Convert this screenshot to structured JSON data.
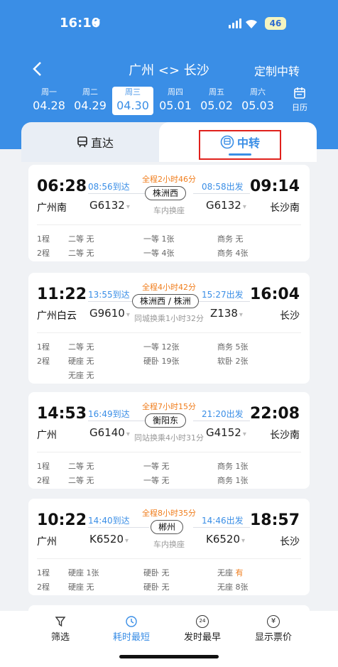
{
  "status_bar": {
    "time": "16:10",
    "battery": "46"
  },
  "nav": {
    "title": "广州 <> 长沙",
    "custom": "定制中转"
  },
  "dates": [
    {
      "weekday": "周一",
      "date": "04.28",
      "selected": false
    },
    {
      "weekday": "周二",
      "date": "04.29",
      "selected": false
    },
    {
      "weekday": "周三",
      "date": "04.30",
      "selected": true
    },
    {
      "weekday": "周四",
      "date": "05.01",
      "selected": false
    },
    {
      "weekday": "周五",
      "date": "05.02",
      "selected": false
    },
    {
      "weekday": "周六",
      "date": "05.03",
      "selected": false
    }
  ],
  "calendar_label": "日历",
  "tabs": {
    "direct": "直达",
    "transfer": "中转"
  },
  "routes": [
    {
      "dep_time": "06:28",
      "dep_station": "广州南",
      "arr_time": "09:14",
      "arr_station": "长沙南",
      "leg1_arrive": "08:56到达",
      "leg2_depart": "08:58出发",
      "total": "全程2小时46分",
      "transfer_station": "株洲西",
      "transfer_note": "车内换座",
      "train1": "G6132",
      "train2": "G6132",
      "seats1": [
        "1程",
        "二等 无",
        "一等 1张",
        "商务 无"
      ],
      "seats2": [
        "2程",
        "二等 无",
        "一等 4张",
        "商务 4张"
      ]
    },
    {
      "dep_time": "11:22",
      "dep_station": "广州白云",
      "arr_time": "16:04",
      "arr_station": "长沙",
      "leg1_arrive": "13:55到达",
      "leg2_depart": "15:27出发",
      "total": "全程4小时42分",
      "transfer_station": "株洲西 / 株洲",
      "transfer_note": "同城换乘1小时32分",
      "train1": "G9610",
      "train2": "Z138",
      "seats1": [
        "1程",
        "二等 无",
        "一等 12张",
        "商务 5张"
      ],
      "seats2": [
        "2程",
        "硬座 无",
        "硬卧 19张",
        "软卧 2张"
      ],
      "seats2_extra": "无座 无"
    },
    {
      "dep_time": "14:53",
      "dep_station": "广州",
      "arr_time": "22:08",
      "arr_station": "长沙南",
      "leg1_arrive": "16:49到达",
      "leg2_depart": "21:20出发",
      "total": "全程7小时15分",
      "transfer_station": "衡阳东",
      "transfer_note": "同站换乘4小时31分",
      "train1": "G6140",
      "train2": "G4152",
      "seats1": [
        "1程",
        "二等 无",
        "一等 无",
        "商务 1张"
      ],
      "seats2": [
        "2程",
        "二等 无",
        "一等 无",
        "商务 1张"
      ]
    },
    {
      "dep_time": "10:22",
      "dep_station": "广州",
      "arr_time": "18:57",
      "arr_station": "长沙",
      "leg1_arrive": "14:40到达",
      "leg2_depart": "14:46出发",
      "total": "全程8小时35分",
      "transfer_station": "郴州",
      "transfer_note": "车内换座",
      "train1": "K6520",
      "train2": "K6520",
      "seats1": [
        "1程",
        "硬座 1张",
        "硬卧 无",
        "无座 "
      ],
      "seats1_highlight": "有",
      "seats2": [
        "2程",
        "硬座 无",
        "硬卧 无",
        "无座 8张"
      ]
    }
  ],
  "bottom_tabs": [
    {
      "label": "筛选",
      "icon": "filter-icon"
    },
    {
      "label": "耗时最短",
      "icon": "clock-icon"
    },
    {
      "label": "发时最早",
      "icon": "24h-icon"
    },
    {
      "label": "显示票价",
      "icon": "yuan-icon"
    }
  ],
  "bottom_icon_text": {
    "hours": "24",
    "yuan": "¥"
  },
  "colors": {
    "primary": "#3a8ee6",
    "orange": "#f07d1c",
    "highlight_box": "#e0211c"
  }
}
